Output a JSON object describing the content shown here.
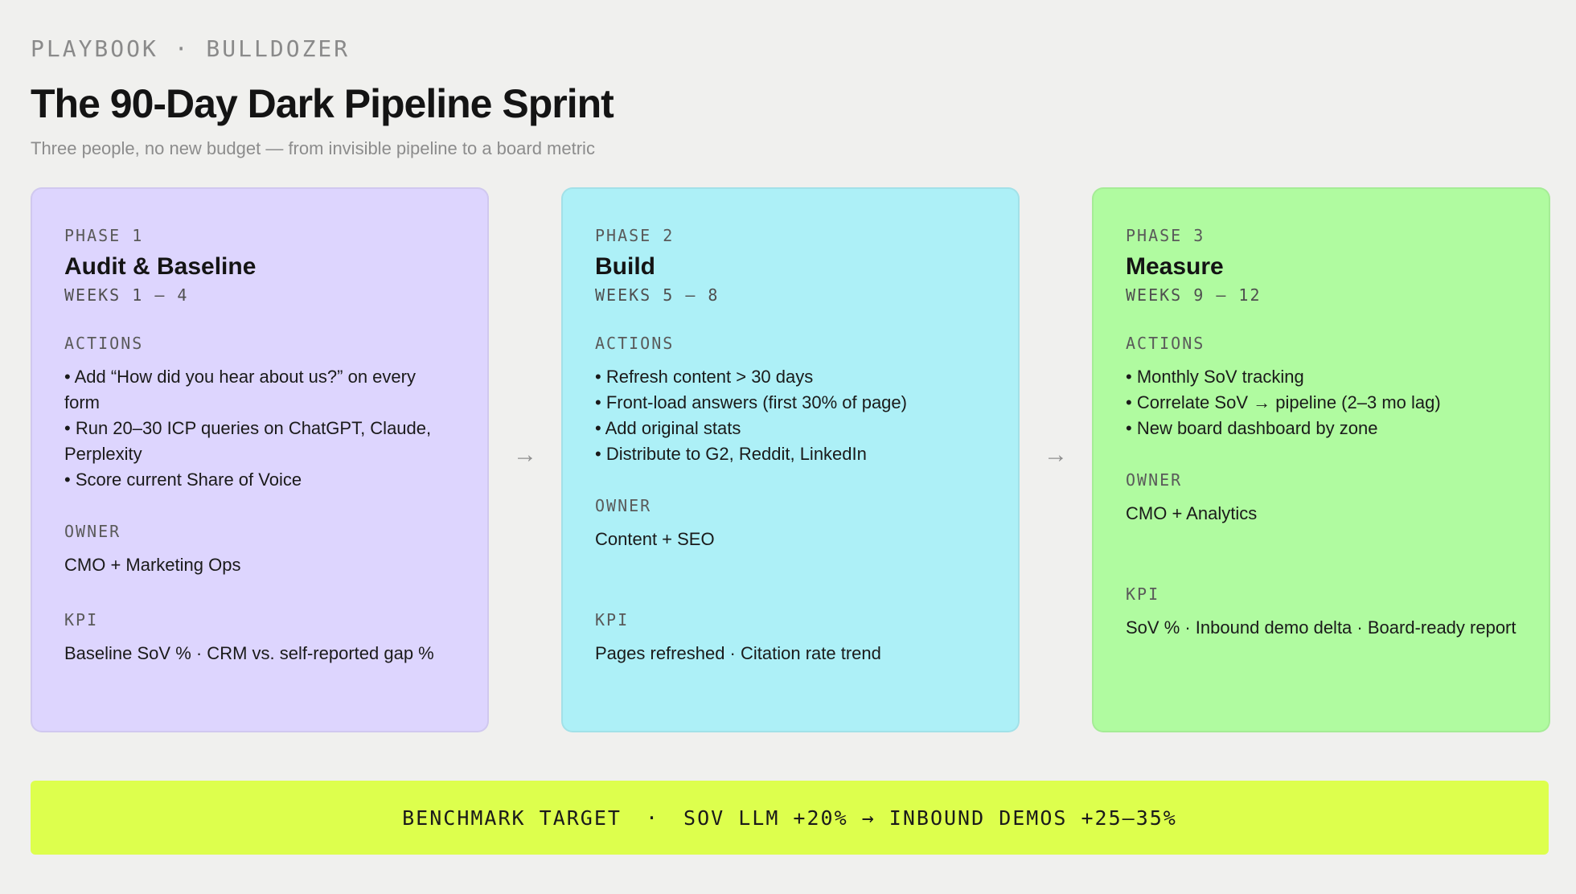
{
  "header": {
    "eyebrow": "PLAYBOOK · BULLDOZER",
    "title": "The 90-Day Dark Pipeline Sprint",
    "subtitle": "Three people, no new budget — from invisible pipeline to a board metric"
  },
  "labels": {
    "actions": "ACTIONS",
    "owner": "OWNER",
    "kpi": "KPI"
  },
  "phases": [
    {
      "phase_label": "PHASE 1",
      "name": "Audit & Baseline",
      "weeks": "WEEKS 1 – 4",
      "color": "#ddd5fe",
      "actions": [
        "• Add “How did you hear about us?” on every form",
        "• Run 20–30 ICP queries on ChatGPT, Claude, Perplexity",
        "• Score current Share of Voice"
      ],
      "owner": "CMO + Marketing Ops",
      "kpi": "Baseline SoV % · CRM vs. self-reported gap %"
    },
    {
      "phase_label": "PHASE 2",
      "name": "Build",
      "weeks": "WEEKS 5 – 8",
      "color": "#adf0f7",
      "actions": [
        "• Refresh content > 30 days",
        "• Front-load answers (first 30% of page)",
        "• Add original stats",
        "• Distribute to G2, Reddit, LinkedIn"
      ],
      "owner": "Content + SEO",
      "kpi": "Pages refreshed · Citation rate trend"
    },
    {
      "phase_label": "PHASE 3",
      "name": "Measure",
      "weeks": "WEEKS 9 – 12",
      "color": "#b0fba0",
      "actions": [
        "• Monthly SoV tracking",
        "• Correlate SoV → pipeline (2–3 mo lag)",
        "• New board dashboard by zone"
      ],
      "owner": "CMO + Analytics",
      "kpi": "SoV % · Inbound demo delta · Board-ready report"
    }
  ],
  "arrow": "→",
  "banner": {
    "label": "BENCHMARK TARGET",
    "separator": "·",
    "value": "SOV LLM +20% → INBOUND DEMOS +25–35%",
    "color": "#ddff4d"
  }
}
